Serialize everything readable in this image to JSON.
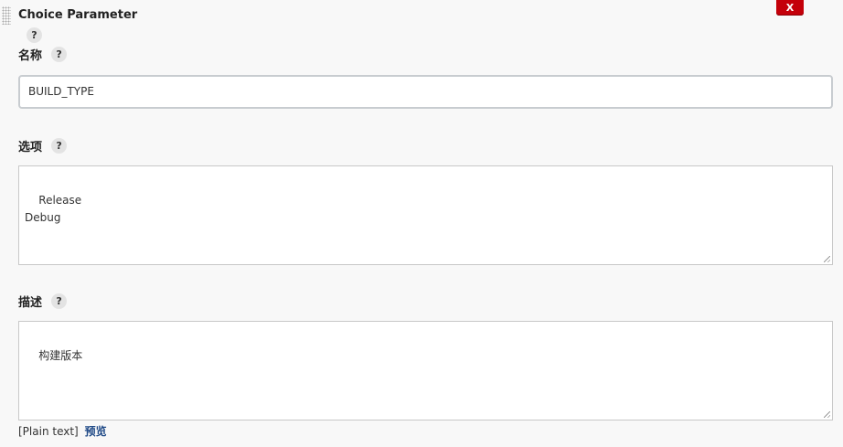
{
  "section": {
    "title": "Choice Parameter",
    "delete_label": "X",
    "help_label": "?"
  },
  "fields": {
    "name": {
      "label": "名称",
      "value": "BUILD_TYPE"
    },
    "choices": {
      "label": "选项",
      "value": "Release\nDebug"
    },
    "description": {
      "label": "描述",
      "value": "构建版本"
    }
  },
  "footer": {
    "format_text": "[Plain text]",
    "preview_link": "预览"
  },
  "colors": {
    "delete_button": "#c4000a",
    "link": "#204a87",
    "background": "#f8f8f8"
  }
}
